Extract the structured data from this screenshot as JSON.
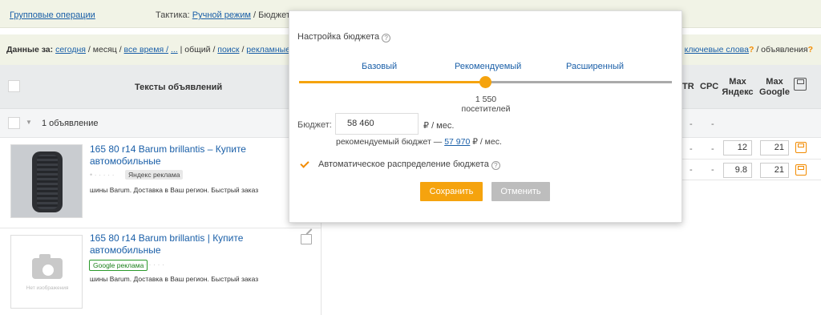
{
  "topbar": {
    "group_ops": "Групповые операции",
    "tactic_label": "Тактика:",
    "tactic_value": "Ручной режим",
    "budget_label": "/ Бюджет: "
  },
  "filters": {
    "data_for": "Данные за:",
    "today": "сегодня",
    "sep1": "/",
    "month": "месяц",
    "sep2": "/",
    "all_time": "все время /",
    "more": "...",
    "sep3": "|",
    "total": "общий",
    "sep4": "/",
    "search": "поиск",
    "sep5": "/",
    "ads": "рекламные",
    "keywords": "ключевые слова",
    "keywords_q": "?",
    "sep6": "/",
    "ads_tab": "объявления",
    "ads_tab_q": "?"
  },
  "table": {
    "header_title": "Тексты объявлений",
    "col_ctr": "TR",
    "col_cpc": "CPC",
    "col_max_yandex": "Max Яндекс",
    "col_max_google": "Max Google",
    "group_label": "1 объявление",
    "dash": "-",
    "rows": [
      {
        "max_yandex": "12",
        "max_google": "21"
      },
      {
        "max_yandex": "9.8",
        "max_google": "21"
      }
    ]
  },
  "ads": [
    {
      "title": "165 80 r14 Barum brillantis – Купите автомобильные",
      "badge": "Яндекс реклама",
      "description": "шины Barum. Доставка в Ваш регион. Быстрый заказ"
    },
    {
      "title": "165 80 r14 Barum brillantis | Купите автомобильные",
      "badge": "Google реклама",
      "description": "шины Barum. Доставка в Ваш регион. Быстрый заказ",
      "no_image": "Нет изображения"
    }
  ],
  "popup": {
    "title": "Настройка бюджета",
    "levels": [
      "Базовый",
      "Рекомендуемый",
      "Расширенный"
    ],
    "slider_value": 0.5,
    "visitors": "1 550 посетителей",
    "budget_label": "Бюджет:",
    "budget_value": "58 460",
    "budget_unit": "/ мес.",
    "currency_icon": "ruble-icon",
    "recommended_prefix": "рекомендуемый бюджет —",
    "recommended_value": "57 970",
    "recommended_unit": "/ мес.",
    "auto_label": "Автоматическое распределение бюджета",
    "auto_checked": true,
    "save_label": "Сохранить",
    "cancel_label": "Отменить"
  },
  "colors": {
    "accent": "#f5a30e",
    "link": "#1a5fa8",
    "header_bg": "#f1f3e6"
  }
}
